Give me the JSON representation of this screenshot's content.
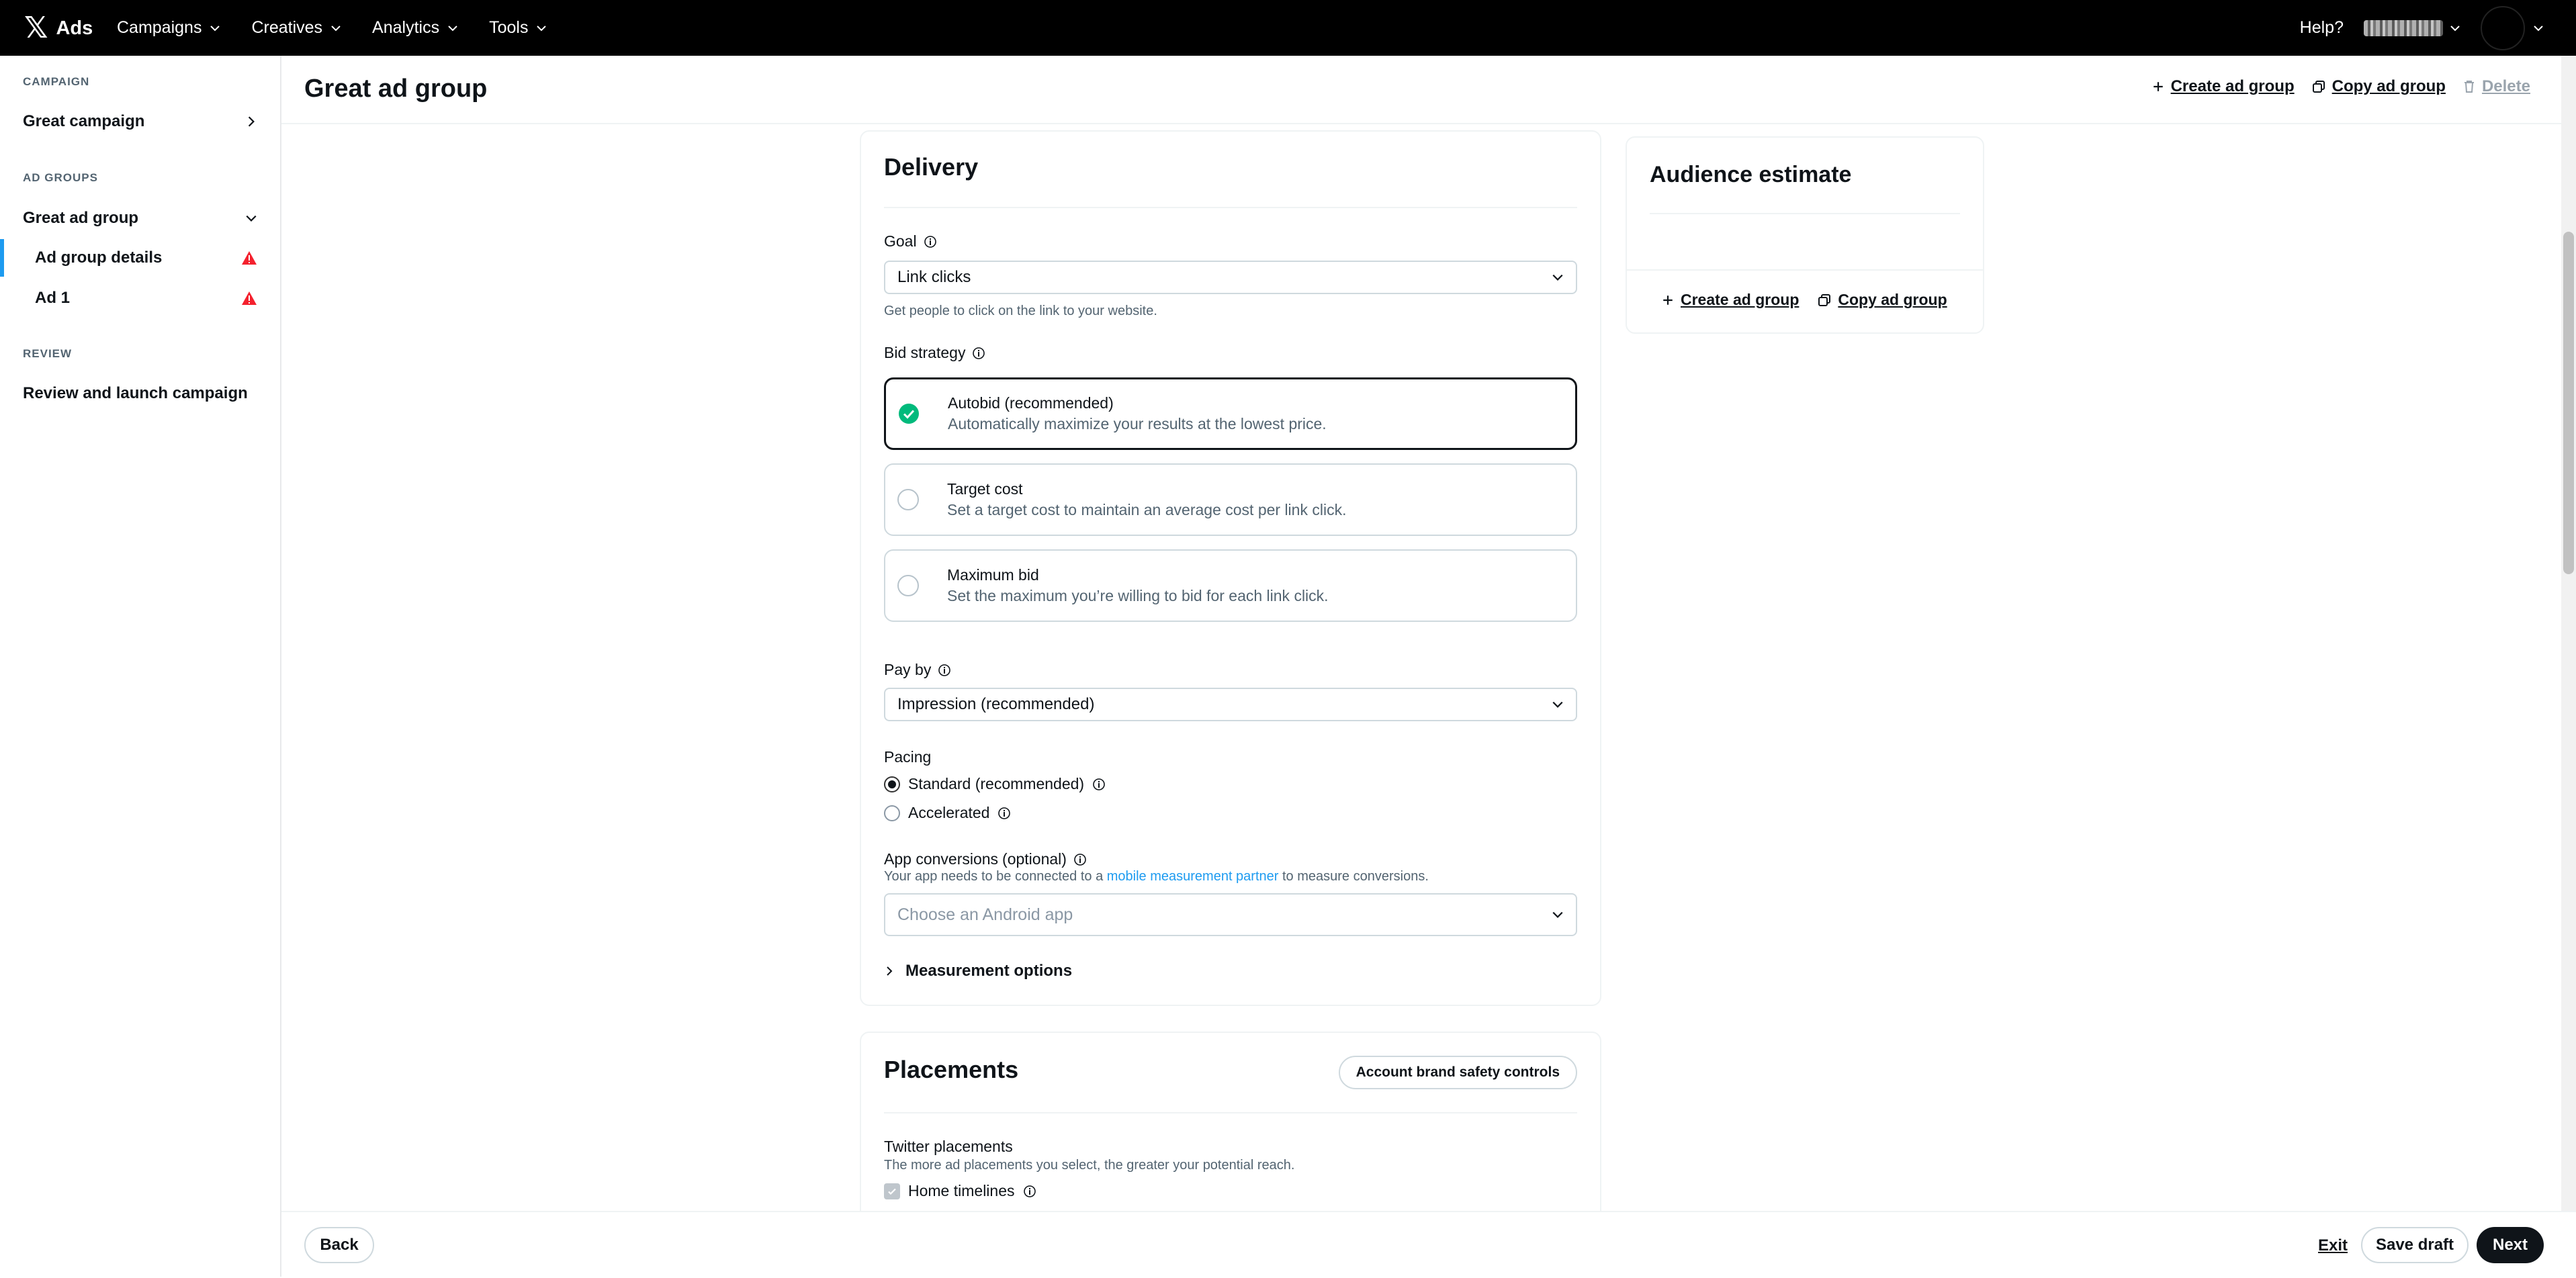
{
  "topnav": {
    "logo_glyph": "𝕏",
    "brand": "Ads",
    "menu": [
      {
        "label": "Campaigns"
      },
      {
        "label": "Creatives"
      },
      {
        "label": "Analytics"
      },
      {
        "label": "Tools"
      }
    ],
    "help": "Help?"
  },
  "sidebar": {
    "campaign_section": "CAMPAIGN",
    "campaign_name": "Great campaign",
    "adgroups_section": "AD GROUPS",
    "adgroup_name": "Great ad group",
    "adgroup_details": "Ad group details",
    "ad_1": "Ad 1",
    "review_section": "REVIEW",
    "review_launch": "Review and launch campaign"
  },
  "header": {
    "title": "Great ad group",
    "create_ad_group": "Create ad group",
    "copy_ad_group": "Copy ad group",
    "delete": "Delete"
  },
  "delivery": {
    "title": "Delivery",
    "goal_label": "Goal",
    "goal_value": "Link clicks",
    "goal_help": "Get people to click on the link to your website.",
    "bid_strategy_label": "Bid strategy",
    "bid_options": [
      {
        "title": "Autobid (recommended)",
        "desc": "Automatically maximize your results at the lowest price."
      },
      {
        "title": "Target cost",
        "desc": "Set a target cost to maintain an average cost per link click."
      },
      {
        "title": "Maximum bid",
        "desc": "Set the maximum you’re willing to bid for each link click."
      }
    ],
    "pay_by_label": "Pay by",
    "pay_by_value": "Impression (recommended)",
    "pacing_label": "Pacing",
    "pacing_standard": "Standard (recommended)",
    "pacing_accelerated": "Accelerated",
    "app_conv_label": "App conversions",
    "app_conv_optional": "(optional)",
    "app_conv_help_pre": "Your app needs to be connected to a ",
    "app_conv_help_link": "mobile measurement partner",
    "app_conv_help_post": " to measure conversions.",
    "app_placeholder": "Choose an Android app",
    "measurement_options": "Measurement options"
  },
  "placements": {
    "title": "Placements",
    "brand_safety_button": "Account brand safety controls",
    "twitter_label": "Twitter placements",
    "twitter_help": "The more ad placements you select, the greater your potential reach.",
    "home_timelines": "Home timelines"
  },
  "audience": {
    "title": "Audience estimate",
    "create_ad_group": "Create ad group",
    "copy_ad_group": "Copy ad group"
  },
  "footer": {
    "back": "Back",
    "exit": "Exit",
    "save_draft": "Save draft",
    "next": "Next"
  },
  "colors": {
    "accent": "#1d9bf0",
    "success": "#00ba7c",
    "warning": "#f4212e"
  }
}
